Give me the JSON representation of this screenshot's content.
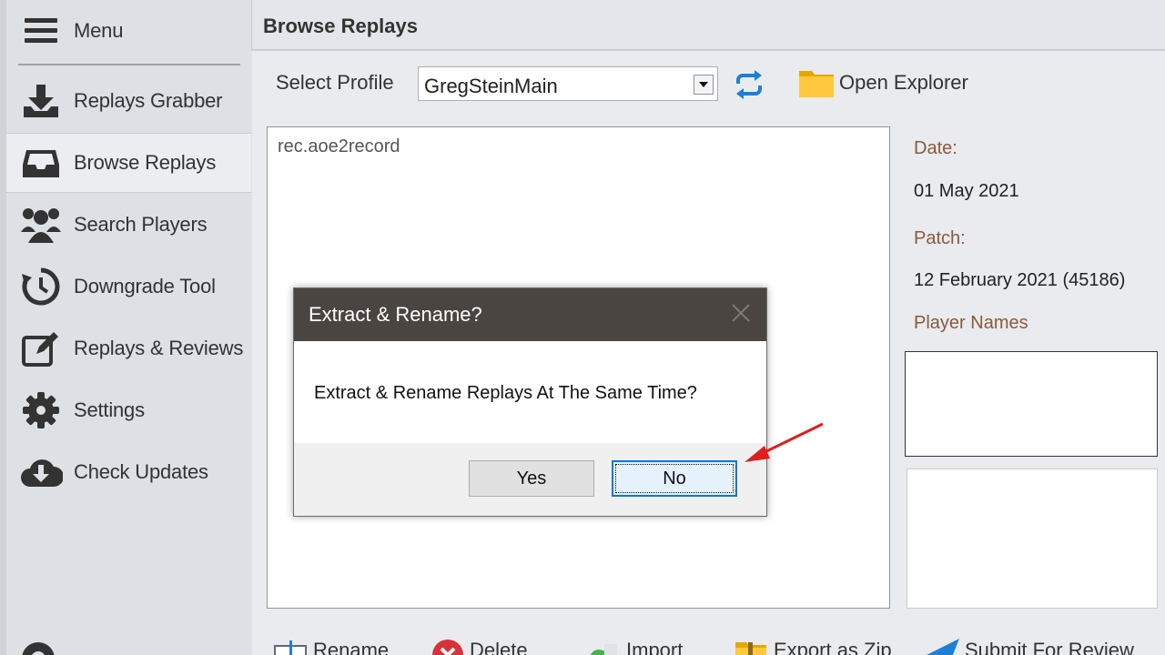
{
  "sidebar": {
    "menu_label": "Menu",
    "items": [
      {
        "label": "Replays Grabber",
        "icon": "download-icon"
      },
      {
        "label": "Browse Replays",
        "icon": "inbox-icon"
      },
      {
        "label": "Search Players",
        "icon": "users-icon"
      },
      {
        "label": "Downgrade Tool",
        "icon": "history-icon"
      },
      {
        "label": "Replays & Reviews",
        "icon": "edit-icon"
      },
      {
        "label": "Settings",
        "icon": "gear-icon"
      },
      {
        "label": "Check Updates",
        "icon": "cloud-download-icon"
      }
    ]
  },
  "header": {
    "title": "Browse Replays"
  },
  "profile": {
    "label": "Select Profile",
    "selected": "GregSteinMain",
    "open_explorer": "Open Explorer"
  },
  "files": [
    "rec.aoe2record"
  ],
  "info": {
    "date_label": "Date:",
    "date_value": "01 May 2021",
    "patch_label": "Patch:",
    "patch_value": "12 February 2021 (45186)",
    "players_label": "Player Names"
  },
  "toolbar": {
    "rename": "Rename",
    "delete": "Delete",
    "import": "Import",
    "export_zip": "Export as Zip",
    "submit": "Submit For Review"
  },
  "dialog": {
    "title": "Extract & Rename?",
    "message": "Extract & Rename Replays At The Same Time?",
    "yes": "Yes",
    "no": "No"
  },
  "colors": {
    "accent_blue": "#0078d7",
    "dialog_title_bg": "#4a4541",
    "label_brown": "#8a5a3c",
    "arrow_red": "#e01e1e"
  }
}
